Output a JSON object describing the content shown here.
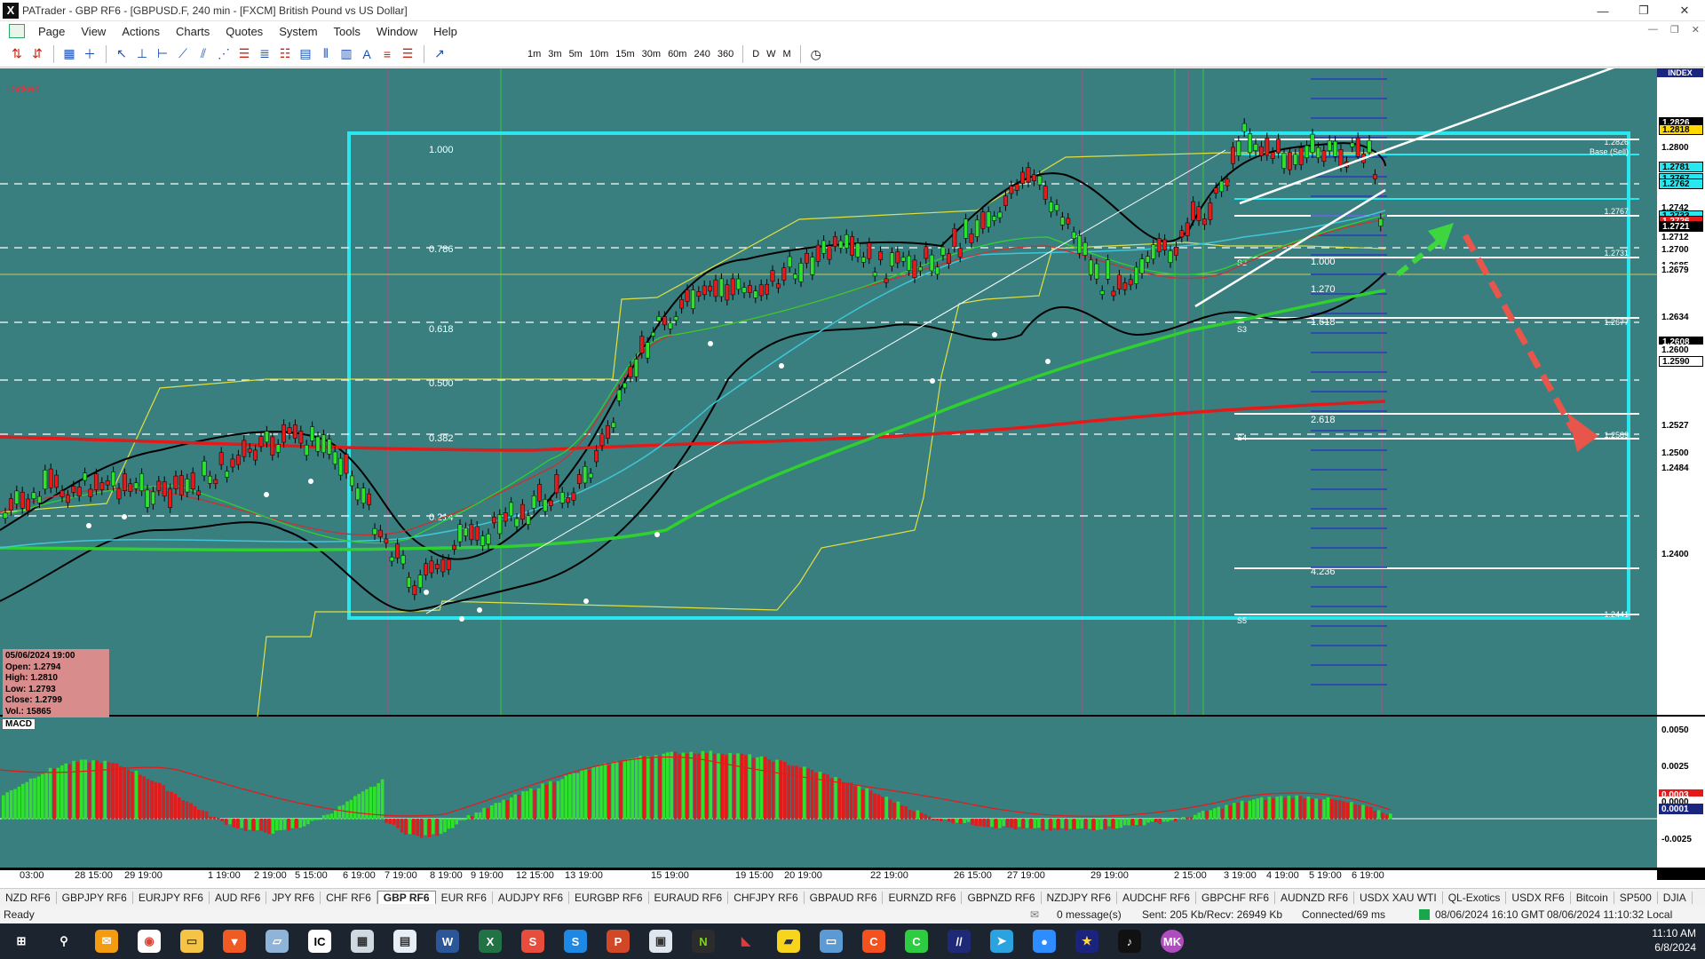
{
  "window": {
    "app_icon": "X",
    "title": "PATrader - GBP RF6 - [GBPUSD.F, 240 min - [FXCM] British Pound vs US Dollar]",
    "controls": [
      "—",
      "❐",
      "✕"
    ]
  },
  "menu": {
    "items": [
      "Page",
      "View",
      "Actions",
      "Charts",
      "Quotes",
      "System",
      "Tools",
      "Window",
      "Help"
    ]
  },
  "toolbar": {
    "timeframes": [
      "1m",
      "3m",
      "5m",
      "10m",
      "15m",
      "30m",
      "60m",
      "240",
      "360",
      "D",
      "W",
      "M"
    ]
  },
  "chart": {
    "locked_label": "Locked",
    "index_tag": "INDEX",
    "fib_labels": [
      "1.000",
      "0.786",
      "0.618",
      "0.500",
      "0.382",
      "0.214"
    ],
    "fib_ext_labels": [
      "1.000",
      "1.270",
      "1.618",
      "2.618",
      "4.236"
    ],
    "right_annotations": [
      "1.2826",
      "Base (Sell)",
      "1.2767",
      "1.2731",
      "1.2677",
      "1.2589",
      "1.2441"
    ],
    "pivot_labels": [
      "S2",
      "S3",
      "S4",
      "S5"
    ],
    "price_axis": [
      "1.2826",
      "1.2818",
      "1.2800",
      "1.2781",
      "1.2767",
      "1.2762",
      "1.2742",
      "1.2733",
      "1.2726",
      "1.2721",
      "1.2712",
      "1.2700",
      "1.2685",
      "1.2679",
      "1.2634",
      "1.2608",
      "1.2600",
      "1.2590",
      "1.2527",
      "1.2500",
      "1.2484",
      "1.2400"
    ],
    "macd_axis": [
      "0.0050",
      "0.0025",
      "0.0003",
      "0.0000",
      "0.0001",
      "-0.0025"
    ],
    "dates": [
      "03:00",
      "28 15:00",
      "29 19:00",
      "1 19:00",
      "2 19:00",
      "5 15:00",
      "6 19:00",
      "7 19:00",
      "8 19:00",
      "9 19:00",
      "12 15:00",
      "13 19:00",
      "15 19:00",
      "19 15:00",
      "20 19:00",
      "22 19:00",
      "26 15:00",
      "27 19:00",
      "29 19:00",
      "2 15:00",
      "3 19:00",
      "4 19:00",
      "5 19:00",
      "6 19:00"
    ]
  },
  "ohlc_box": {
    "date": "05/06/2024 19:00",
    "open": "Open: 1.2794",
    "high": "High: 1.2810",
    "low": "Low: 1.2793",
    "close": "Close: 1.2799",
    "vol": "Vol.: 15865"
  },
  "macd_label": "MACD",
  "tabs": [
    "NZD RF6",
    "GBPJPY RF6",
    "EURJPY RF6",
    "AUD RF6",
    "JPY RF6",
    "CHF RF6",
    "GBP RF6",
    "EUR RF6",
    "AUDJPY RF6",
    "EURGBP RF6",
    "EURAUD RF6",
    "CHFJPY RF6",
    "GBPAUD RF6",
    "EURNZD RF6",
    "GBPNZD RF6",
    "NZDJPY RF6",
    "AUDCHF RF6",
    "GBPCHF RF6",
    "AUDNZD RF6",
    "USDX XAU WTI",
    "QL-Exotics",
    "USDX RF6",
    "Bitcoin",
    "SP500",
    "DJIA"
  ],
  "active_tab": "GBP RF6",
  "status": {
    "ready": "Ready",
    "messages": "0 message(s)",
    "traffic": "Sent: 205 Kb/Recv: 26949 Kb",
    "connection": "Connected/69 ms",
    "gmt": "08/06/2024 16:10 GMT",
    "local": "08/06/2024 11:10:32 Local"
  },
  "taskbar": {
    "time": "11:10 AM",
    "date": "6/8/2024"
  }
}
